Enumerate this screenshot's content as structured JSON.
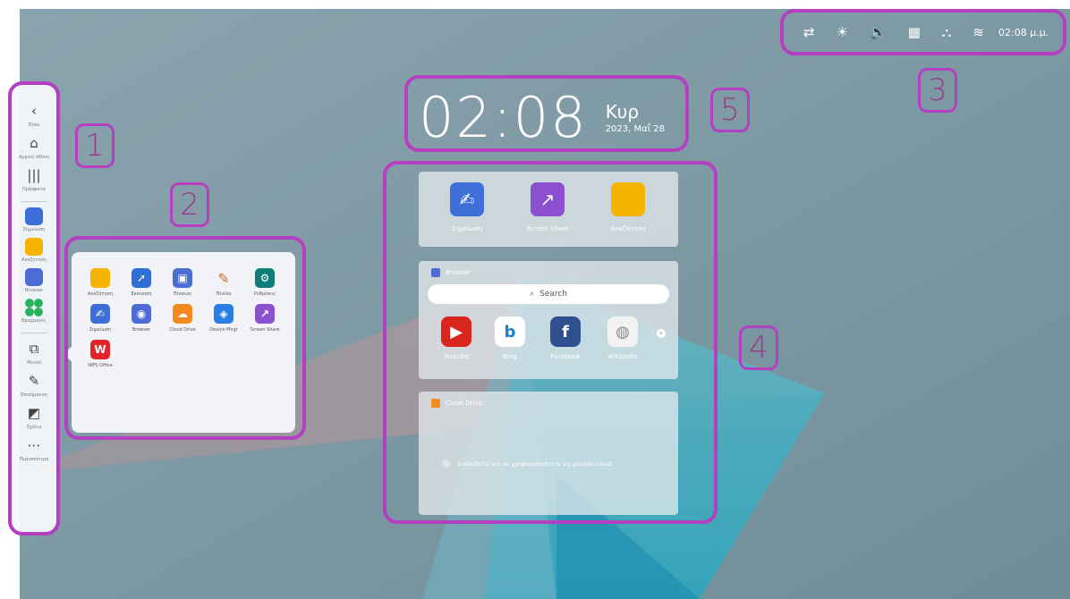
{
  "sidebar": {
    "items": [
      {
        "icon": "chevron-left-icon",
        "glyph": "‹",
        "label": "Πίσω"
      },
      {
        "icon": "home-icon",
        "glyph": "⌂",
        "label": "Αρχική οθόνη"
      },
      {
        "icon": "recents-icon",
        "glyph": "|||",
        "label": "Πρόσφατα"
      }
    ],
    "apps": [
      {
        "icon": "annotation-app-icon",
        "label": "Σημείωση",
        "color": "#3e6fd8"
      },
      {
        "icon": "folder-app-icon",
        "label": "Αναζήτηση",
        "color": "#f5b400"
      },
      {
        "icon": "browser-app-icon",
        "label": "Browser",
        "color": "#4d6cd6"
      },
      {
        "icon": "all-apps-icon",
        "label": "Εφαρμογές",
        "color": "#27b35e"
      }
    ],
    "tools": [
      {
        "icon": "windows-icon",
        "glyph": "⧉",
        "label": "Μενού"
      },
      {
        "icon": "pen-icon",
        "glyph": "✎",
        "label": "Επισήμανση"
      },
      {
        "icon": "capture-icon",
        "glyph": "◩",
        "label": "Σχόλιο"
      },
      {
        "icon": "more-icon",
        "glyph": "⋯",
        "label": "Περισσότερα"
      }
    ]
  },
  "apps_panel": {
    "apps": [
      {
        "icon": "folder-icon",
        "label": "Αναζήτηση",
        "color": "#f5b400",
        "glyph": ""
      },
      {
        "icon": "rocket-icon",
        "label": "Εκκίνηση",
        "color": "#2f6fd6",
        "glyph": "➚"
      },
      {
        "icon": "whiteboard-icon",
        "label": "Πίνακας",
        "color": "#4b6fd0",
        "glyph": "▣"
      },
      {
        "icon": "brush-icon",
        "label": "Πινέλο",
        "color": "#3a3a3a",
        "glyph": "🖌"
      },
      {
        "icon": "settings-icon",
        "label": "Ρυθμίσεις",
        "color": "#0f7d78",
        "glyph": "⚙"
      },
      {
        "icon": "annotation-icon",
        "label": "Σημείωση",
        "color": "#3e6fd8",
        "glyph": "✍"
      },
      {
        "icon": "browser-icon",
        "label": "Browser",
        "color": "#4d6cd6",
        "glyph": "◉"
      },
      {
        "icon": "cloud-drive-icon",
        "label": "Cloud Drive",
        "color": "#f58a1f",
        "glyph": "☁"
      },
      {
        "icon": "device-manager-icon",
        "label": "Device Mngr",
        "color": "#2a7de1",
        "glyph": "◈"
      },
      {
        "icon": "screen-share-icon",
        "label": "Screen Share",
        "color": "#8b4fcf",
        "glyph": "↗"
      },
      {
        "icon": "wps-office-icon",
        "label": "WPS Office",
        "color": "#e2242a",
        "glyph": "W"
      }
    ]
  },
  "status": {
    "icons": [
      "input-source-icon",
      "brightness-icon",
      "volume-icon",
      "display-icon",
      "network-icon",
      "wifi-icon"
    ],
    "glyphs": [
      "⇄",
      "☀",
      "🔈",
      "▦",
      "⛬",
      "≋"
    ],
    "time": "02:08 μ.μ."
  },
  "clock": {
    "time": "02:08",
    "day": "Κυρ",
    "date": "2023, Μαΐ 28"
  },
  "quick_apps": [
    {
      "icon": "annotation-icon",
      "label": "Σημείωση",
      "color": "#3e6fd8",
      "glyph": "✍"
    },
    {
      "icon": "screen-share-icon",
      "label": "Screen Share",
      "color": "#8b4fcf",
      "glyph": "↗"
    },
    {
      "icon": "folder-icon",
      "label": "Αναζήτηση",
      "color": "#f5b400",
      "glyph": ""
    }
  ],
  "browser_widget": {
    "title": "Browser",
    "search_placeholder": "Search",
    "bookmarks": [
      {
        "icon": "youtube-icon",
        "label": "Youtube",
        "color": "#d9261c",
        "glyph": "▶"
      },
      {
        "icon": "bing-icon",
        "label": "Bing",
        "color": "#ffffff",
        "glyph": "b"
      },
      {
        "icon": "facebook-icon",
        "label": "Facebook",
        "color": "#2f4f8f",
        "glyph": "f"
      },
      {
        "icon": "wikipedia-icon",
        "label": "Wikipedia",
        "color": "#f2f2f2",
        "glyph": "◍"
      }
    ]
  },
  "cloud_widget": {
    "title": "Cloud Drive",
    "message": "Συνδεθείτε για να χρησιμοποιήσετε τη μονάδα cloud."
  },
  "annotations": [
    "1",
    "2",
    "3",
    "4",
    "5"
  ]
}
